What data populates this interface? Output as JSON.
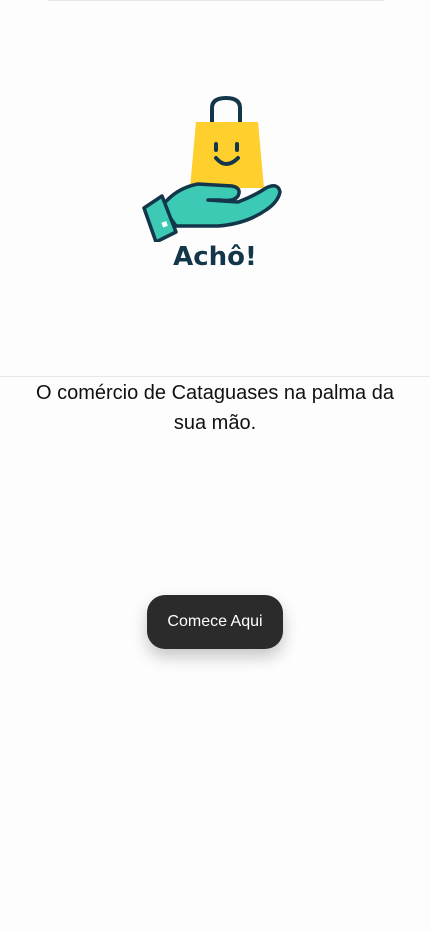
{
  "logo": {
    "text": "Achô!",
    "icon": "hand-with-smiling-shopping-bag",
    "colors": {
      "bag": "#FFCF2E",
      "hand": "#3CCAB4",
      "outline": "#13364A"
    }
  },
  "tagline": "O comércio de Cataguases na palma da sua mão.",
  "cta": {
    "label": "Comece Aqui",
    "color": "#2B2B2B"
  }
}
